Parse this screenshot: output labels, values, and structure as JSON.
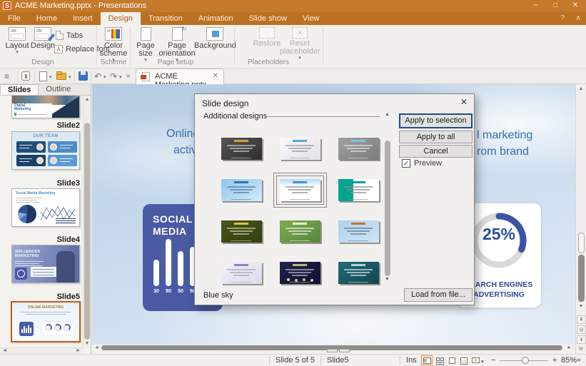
{
  "titlebar": {
    "title": "ACME Marketing.pptx - Presentations",
    "app_initial": "S",
    "controls": {
      "minimize": "─",
      "maximize": "□",
      "close": "✕"
    }
  },
  "menubar": {
    "items": [
      "File",
      "Home",
      "Insert",
      "Design",
      "Transition",
      "Animation",
      "Slide show",
      "View"
    ],
    "active": "Design",
    "help": "?",
    "collapse": "∧"
  },
  "ribbon": {
    "design_group": {
      "caption": "Design",
      "layout": "Layout",
      "design": "Design",
      "tabs": "Tabs",
      "replace_font": "Replace font"
    },
    "scheme_group": {
      "caption": "Scheme",
      "color_scheme": "Color scheme"
    },
    "page_group": {
      "caption": "Page setup",
      "page_size": "Page size",
      "page_orientation": "Page orientation",
      "background": "Background"
    },
    "placeholders_group": {
      "caption": "Placeholders",
      "restore": "Restore",
      "reset_placeholder": "Reset placeholder"
    }
  },
  "qat": {
    "overflow": "»",
    "undo": "↶",
    "redo": "↷",
    "menu": "≡"
  },
  "document_tab": {
    "label": "ACME Marketing.pptx",
    "close": "✕"
  },
  "sidebar": {
    "tab_slides": "Slides",
    "tab_outline": "Outline",
    "slide1": {
      "title": "Digital Marketing"
    },
    "slide2": {
      "name": "Slide2",
      "title": "OUR TEAM"
    },
    "slide3": {
      "name": "Slide3",
      "title": "Social Media Marketing"
    },
    "slide4": {
      "name": "Slide4",
      "title_line1": "INFLUENCER",
      "title_line2": "MARKETING"
    },
    "slide5": {
      "name": "Slide5",
      "title": "ONLINE MARKETING"
    }
  },
  "canvas": {
    "title_frag_left1": "Online m",
    "title_frag_left2": "activiti",
    "title_frag_right1": "l marketing",
    "title_frag_right2": "rom brand",
    "social": {
      "title_line1": "SOCIAL",
      "title_line2": "MEDIA",
      "values": [
        30,
        80,
        50,
        60
      ]
    },
    "gauge": {
      "value": "25%",
      "percent": 25,
      "line1": "SEARCH ENGINES",
      "line2": "ADVERTISING",
      "arc_color": "#3B54A5",
      "ring_color": "#D9D9D9"
    }
  },
  "dialog": {
    "title": "Slide design",
    "close": "✕",
    "section_label": "Additional designs",
    "apply_selection": "Apply to selection",
    "apply_all": "Apply to all",
    "cancel": "Cancel",
    "preview": "Preview",
    "preview_checked": "✓",
    "selected_name": "Blue sky",
    "load_from_file": "Load from file...",
    "designs": [
      {
        "variant": "plain",
        "bg": "#565656",
        "bg2": "#2E2E2E",
        "title": "#E09A30",
        "text": "#C8C8C8"
      },
      {
        "variant": "plain",
        "bg": "#FAFAFA",
        "bg2": "#E2E2E8",
        "title": "#52A8DC",
        "text": "#9A9AA0"
      },
      {
        "variant": "plain",
        "bg": "#A2A2A2",
        "bg2": "#7A7A7A",
        "title": "#7CC4E8",
        "text": "#E0E0E0"
      },
      {
        "variant": "plain",
        "bg": "#8FC6EC",
        "bg2": "#D2EAFA",
        "title": "#2E74B5",
        "text": "#5580A0"
      },
      {
        "variant": "top",
        "bg": "#B6D9F0",
        "bg2": "#FFFFFF",
        "title": "#4A90C8",
        "text": "#909090",
        "selected": true,
        "name": "Blue sky"
      },
      {
        "variant": "left",
        "bg": "#00A491",
        "bg2": "#FFFFFF",
        "title": "#00A491",
        "text": "#909090"
      },
      {
        "variant": "plain",
        "bg": "#49571B",
        "bg2": "#333F12",
        "title": "#D8C63A",
        "text": "#C2C8A0"
      },
      {
        "variant": "plain",
        "bg": "#7FAA50",
        "bg2": "#58873B",
        "title": "#EAEFD8",
        "text": "#E6EEDC"
      },
      {
        "variant": "plain",
        "bg": "#AFD2EE",
        "bg2": "#CCE4F6",
        "title": "#C07820",
        "text": "#6A7E92"
      },
      {
        "variant": "plain",
        "bg": "#F2F2FA",
        "bg2": "#DADAEC",
        "title": "#8888C0",
        "text": "#A8A8B8"
      },
      {
        "variant": "lights",
        "bg": "#23234E",
        "bg2": "#0F0F30",
        "title": "#BCBC6A",
        "text": "#B8B8C8"
      },
      {
        "variant": "plain",
        "bg": "#236B78",
        "bg2": "#12454E",
        "title": "#A8D8E0",
        "text": "#CBE4E8"
      }
    ]
  },
  "statusbar": {
    "slide_info": "Slide 5 of 5",
    "slide_name": "Slide5",
    "insert_mode": "Ins",
    "zoom_level": "85%",
    "overflow": "»"
  }
}
